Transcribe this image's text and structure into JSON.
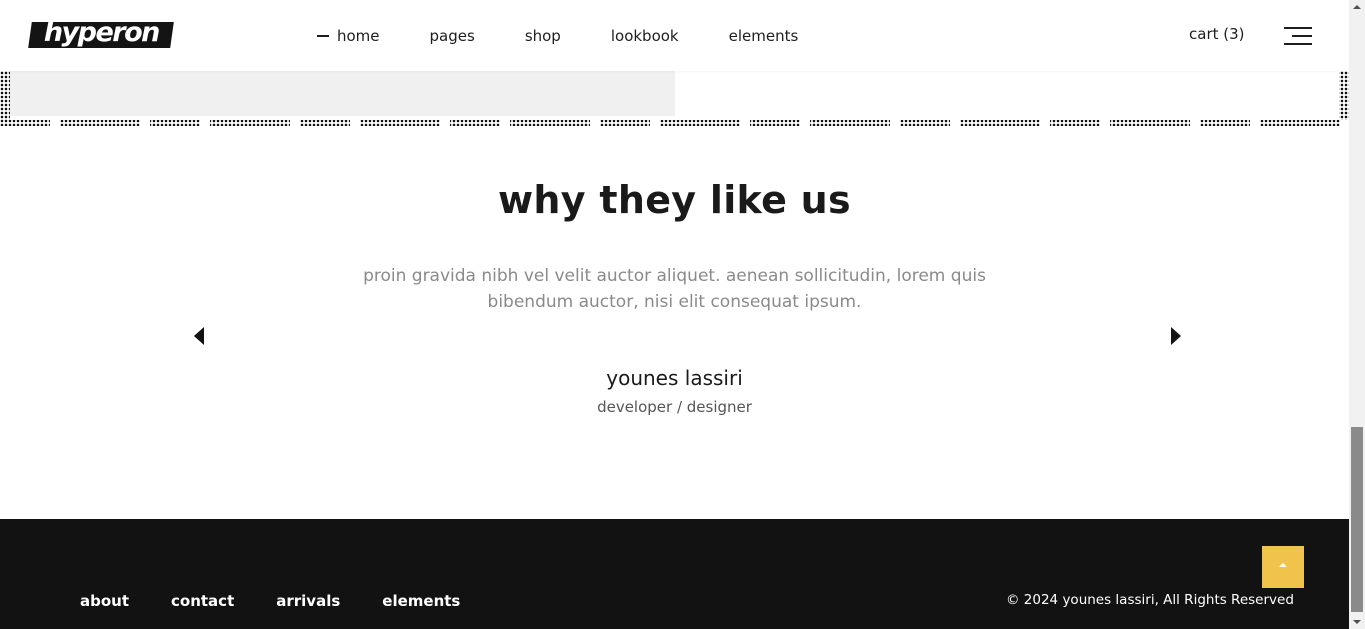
{
  "header": {
    "logo_text": "hyperon",
    "nav": [
      {
        "label": "home",
        "active": true
      },
      {
        "label": "pages"
      },
      {
        "label": "shop"
      },
      {
        "label": "lookbook"
      },
      {
        "label": "elements"
      }
    ],
    "cart_label": "cart (3)",
    "menu_icon": "hamburger-icon"
  },
  "testimonials": {
    "title": "why they like us",
    "quote": "proin gravida nibh vel velit auctor aliquet. aenean sollicitudin, lorem quis bibendum auctor, nisi elit consequat ipsum.",
    "author": "younes lassiri",
    "role": "developer / designer",
    "prev_icon": "caret-left-icon",
    "next_icon": "caret-right-icon"
  },
  "footer": {
    "links": [
      "about",
      "contact",
      "arrivals",
      "elements"
    ],
    "copyright": "© 2024 younes lassiri, All Rights Reserved",
    "to_top_icon": "arrow-up-icon"
  },
  "colors": {
    "accent": "#f0c34a",
    "footer_bg": "#121212",
    "text_dark": "#1a1a1a",
    "text_muted": "#8a8a8a"
  }
}
